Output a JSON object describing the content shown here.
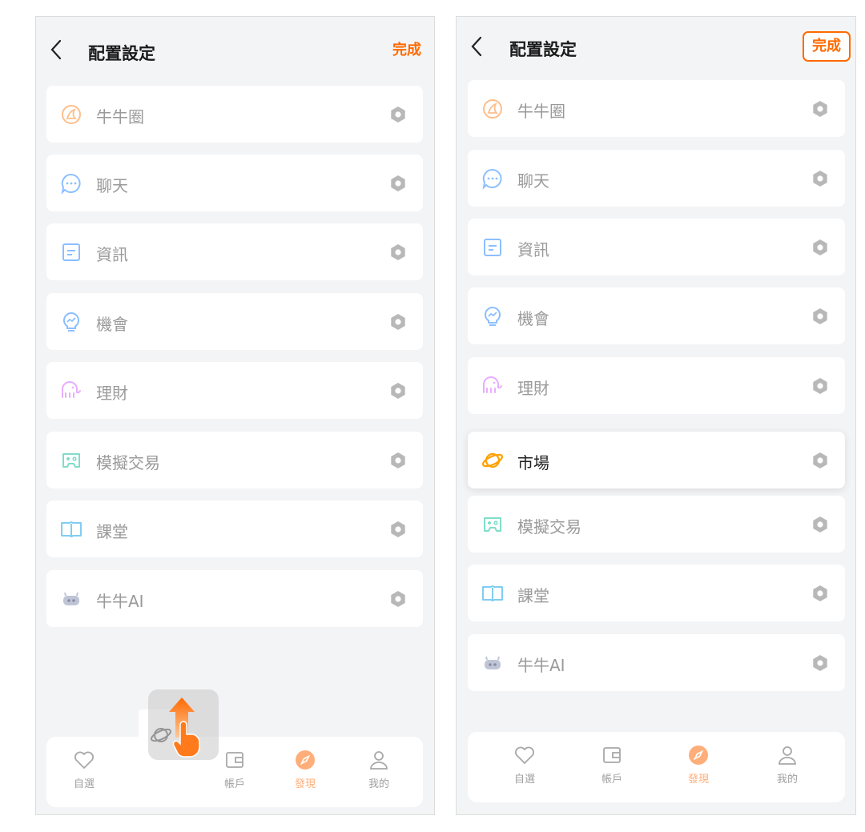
{
  "colors": {
    "accent": "#ff6a00",
    "tab_active": "#ffae7a",
    "gear": "#b8b8b8",
    "bg": "#f3f4f6"
  },
  "header": {
    "title": "配置設定",
    "done": "完成",
    "back_icon": "chevron-left-icon"
  },
  "left_items": [
    {
      "label": "牛牛圈",
      "icon": "moments-icon"
    },
    {
      "label": "聊天",
      "icon": "chat-bubble-icon"
    },
    {
      "label": "資訊",
      "icon": "news-document-icon"
    },
    {
      "label": "機會",
      "icon": "lightbulb-icon"
    },
    {
      "label": "理財",
      "icon": "elephant-icon"
    },
    {
      "label": "模擬交易",
      "icon": "gamepad-icon"
    },
    {
      "label": "課堂",
      "icon": "open-book-icon"
    },
    {
      "label": "牛牛AI",
      "icon": "robot-icon"
    }
  ],
  "right_items": [
    {
      "label": "牛牛圈",
      "icon": "moments-icon"
    },
    {
      "label": "聊天",
      "icon": "chat-bubble-icon"
    },
    {
      "label": "資訊",
      "icon": "news-document-icon"
    },
    {
      "label": "機會",
      "icon": "lightbulb-icon"
    },
    {
      "label": "理財",
      "icon": "elephant-icon"
    },
    {
      "label": "市場",
      "icon": "planet-icon",
      "active": true
    },
    {
      "label": "模擬交易",
      "icon": "gamepad-icon"
    },
    {
      "label": "課堂",
      "icon": "open-book-icon"
    },
    {
      "label": "牛牛AI",
      "icon": "robot-icon"
    }
  ],
  "tabs": {
    "watchlist": "自選",
    "account": "帳戶",
    "discover": "發現",
    "me": "我的"
  },
  "drag_hint": {
    "dragged_icon": "planet-icon",
    "gesture_icon": "swipe-up-hand-icon"
  }
}
